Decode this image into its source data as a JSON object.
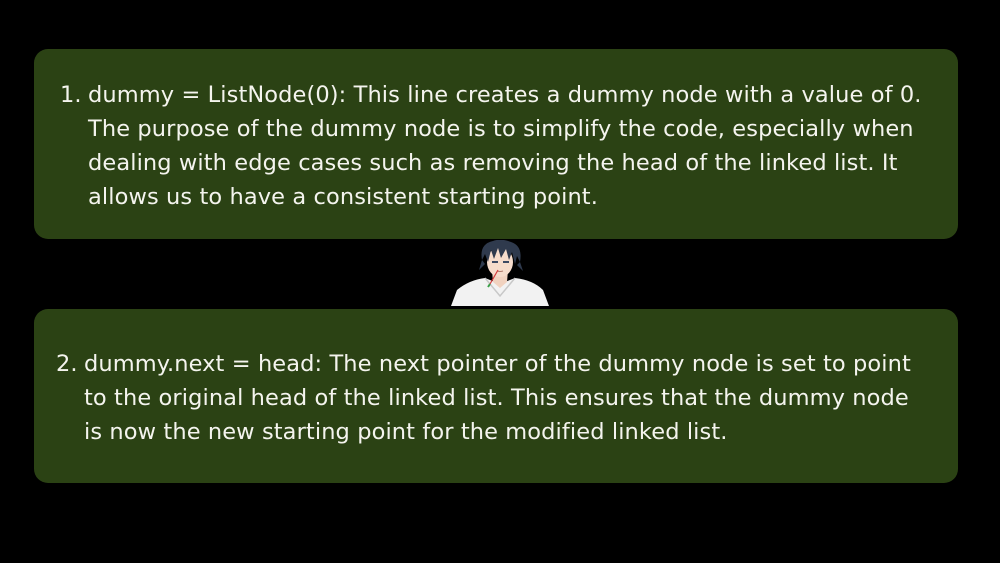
{
  "items": [
    {
      "number": "1.",
      "text": "dummy = ListNode(0): This line creates a dummy node with a value of 0. The purpose of the dummy node is to simplify the code, especially when dealing with edge cases such as removing the head of the linked list. It allows us to have a consistent starting point."
    },
    {
      "number": "2.",
      "text": "dummy.next = head: The next pointer of the dummy node is set to point to the original head of the linked list. This ensures that the dummy node is now the new starting point for the modified linked list."
    }
  ],
  "colors": {
    "background": "#000000",
    "card": "#2b4214",
    "text": "#f4f4ee"
  },
  "avatar": {
    "icon": "anime-character-avatar"
  }
}
